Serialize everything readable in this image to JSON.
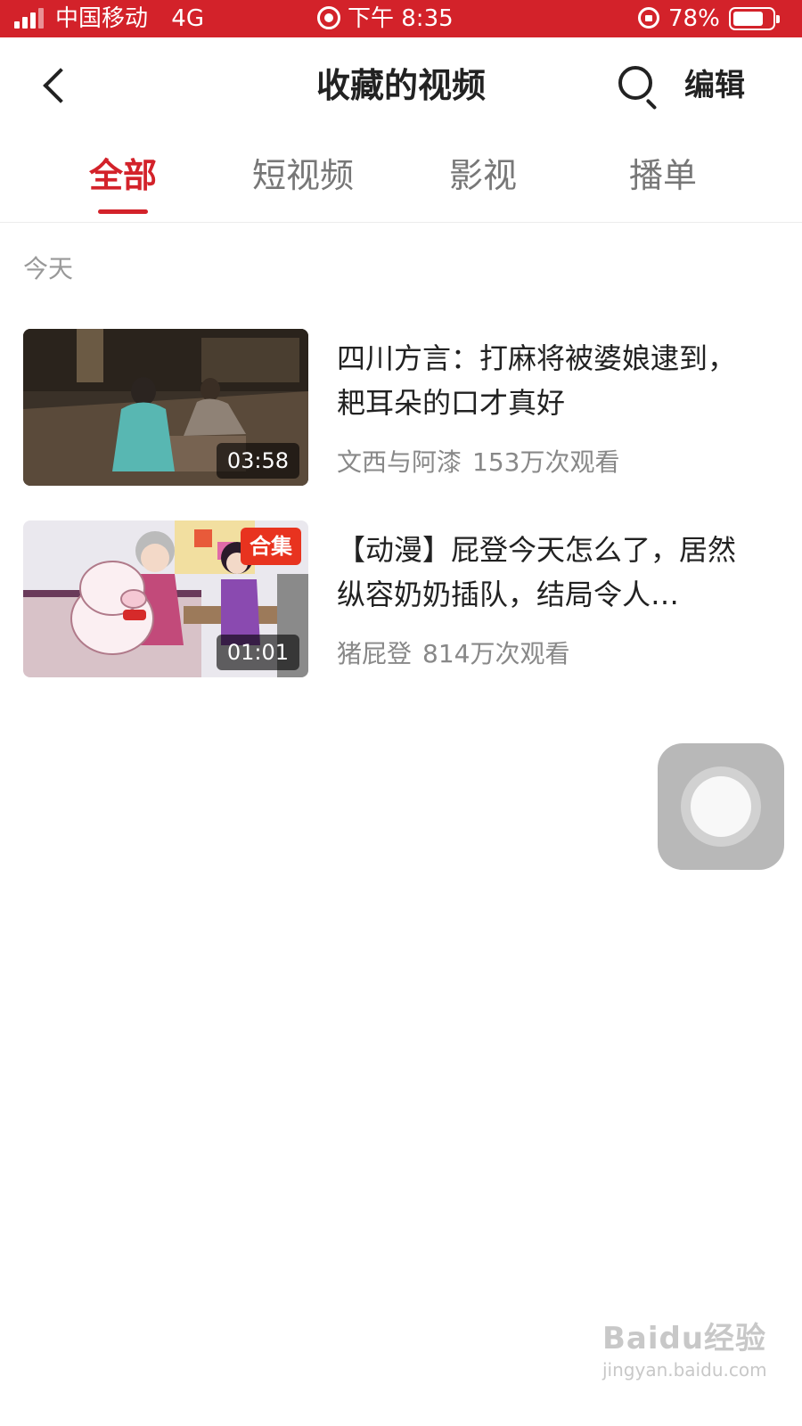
{
  "status_bar": {
    "carrier": "中国移动",
    "network": "4G",
    "time": "下午 8:35",
    "battery_percent": "78%",
    "battery_level": 0.78,
    "signal_bars": 4
  },
  "header": {
    "back_icon": "chevron-left-icon",
    "title": "收藏的视频",
    "search_icon": "search-icon",
    "edit_label": "编辑"
  },
  "tabs": [
    {
      "label": "全部",
      "active": true
    },
    {
      "label": "短视频",
      "active": false
    },
    {
      "label": "影视",
      "active": false
    },
    {
      "label": "播单",
      "active": false
    }
  ],
  "section": {
    "label": "今天"
  },
  "videos": [
    {
      "title": "四川方言：打麻将被婆娘逮到，耙耳朵的口才真好",
      "author": "文西与阿漆",
      "views": "153万次观看",
      "duration": "03:58",
      "badge": ""
    },
    {
      "title": "【动漫】屁登今天怎么了，居然纵容奶奶插队，结局令人…",
      "author": "猪屁登",
      "views": "814万次观看",
      "duration": "01:01",
      "badge": "合集"
    }
  ],
  "watermark": {
    "brand": "Baidu经验",
    "url": "jingyan.baidu.com"
  },
  "colors": {
    "accent": "#d3222a",
    "text_primary": "#222222",
    "text_secondary": "#888888",
    "badge": "#e8331f"
  }
}
